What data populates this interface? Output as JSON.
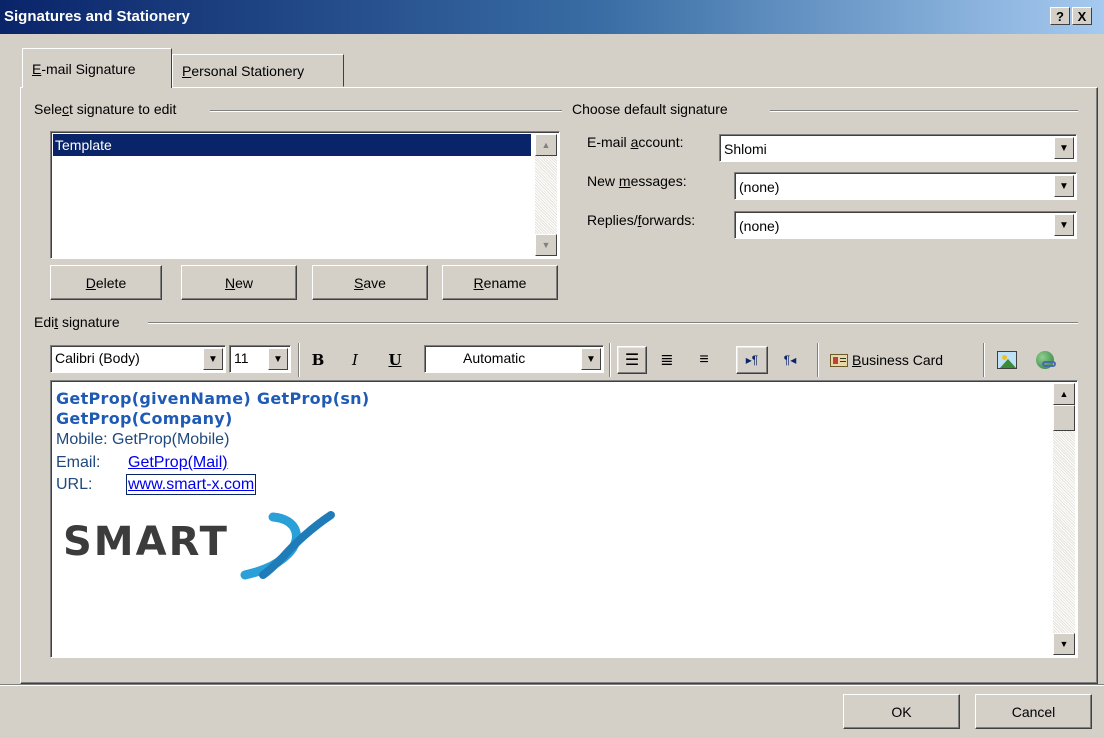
{
  "window": {
    "title": "Signatures and Stationery",
    "help_glyph": "?",
    "close_glyph": "X"
  },
  "tabs": [
    {
      "label": "E-mail Signature",
      "mnemonic": "E",
      "rest": "-mail Signature",
      "active": true
    },
    {
      "label": "Personal Stationery",
      "mnemonic": "P",
      "rest": "ersonal Stationery",
      "active": false
    }
  ],
  "select_group": {
    "header_pre": "Sele",
    "header_mn": "c",
    "header_post": "t signature to edit",
    "items": [
      "Template"
    ],
    "selected_index": 0
  },
  "buttons": {
    "delete": {
      "mn": "D",
      "rest": "elete"
    },
    "new": {
      "mn": "N",
      "rest": "ew"
    },
    "save": {
      "mn": "S",
      "rest": "ave"
    },
    "rename": {
      "mn": "R",
      "rest": "ename"
    }
  },
  "default_group": {
    "header": "Choose default signature",
    "email_account": {
      "pre": "E-mail ",
      "mn": "a",
      "post": "ccount:",
      "value": "Shlomi"
    },
    "new_messages": {
      "pre": "New ",
      "mn": "m",
      "post": "essages:",
      "value": "(none)"
    },
    "replies": {
      "pre": "Replies/",
      "mn": "f",
      "post": "orwards:",
      "value": "(none)"
    }
  },
  "edit_group": {
    "header_pre": "Edi",
    "header_mn": "t",
    "header_post": " signature"
  },
  "toolbar": {
    "font": "Calibri (Body)",
    "size": "11",
    "bold": "B",
    "italic": "I",
    "underline": "U",
    "color": "Automatic",
    "business_card_mn": "B",
    "business_card_rest": "usiness Card"
  },
  "signature": {
    "line1": "GetProp(givenName) GetProp(sn)",
    "line2": "GetProp(Company)",
    "mobile_label": "Mobile: ",
    "mobile_value": "GetProp(Mobile)",
    "email_label": "Email:",
    "email_value": "GetProp(Mail)",
    "url_label": "URL:",
    "url_value": "www.smart-x.com",
    "logo_text": "SMART",
    "logo_x": "X"
  },
  "footer": {
    "ok": "OK",
    "cancel": "Cancel"
  },
  "colors": {
    "title_start": "#0a246a",
    "title_end": "#a6caf0",
    "selection": "#0a246a",
    "signature_blue": "#1f497d",
    "logo_gray": "#3c3c3c",
    "logo_x_blue": "#2aa0d8"
  }
}
